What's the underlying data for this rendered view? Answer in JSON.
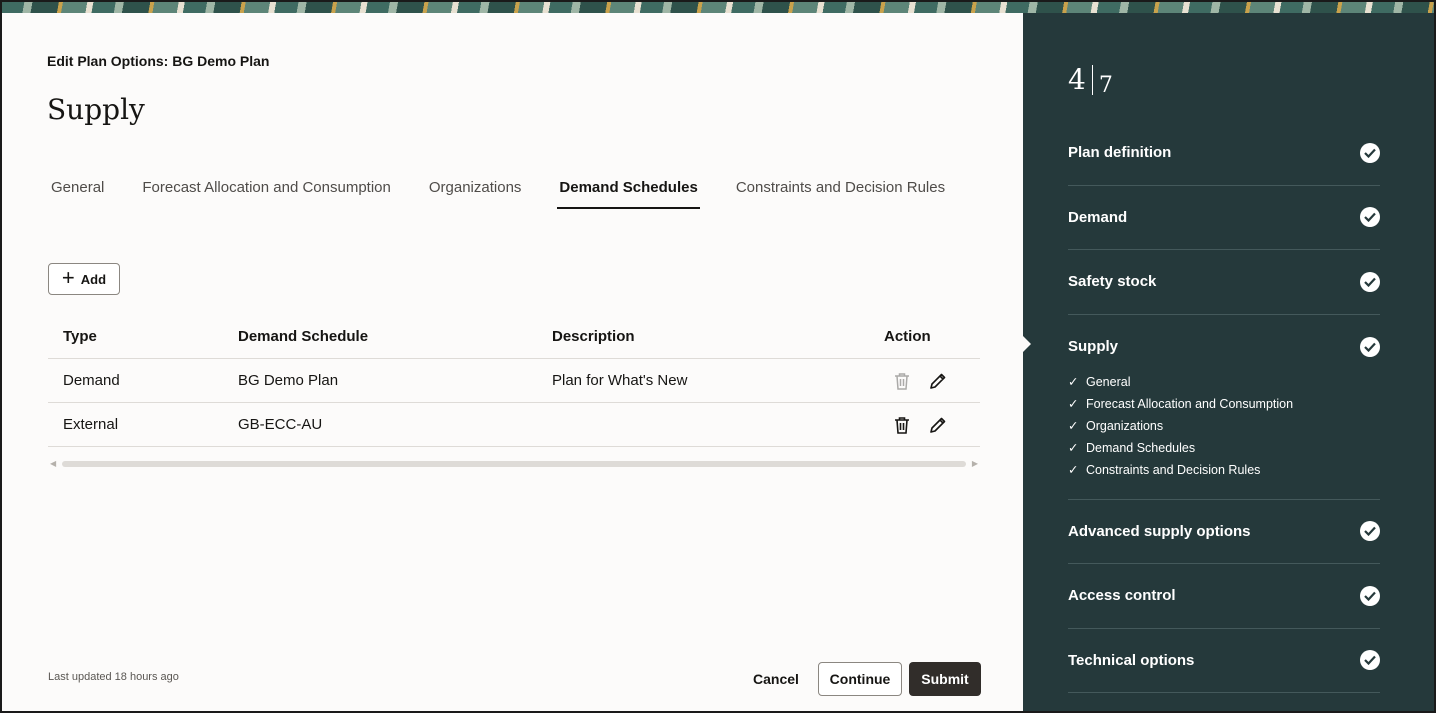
{
  "page": {
    "subtitle": "Edit Plan Options: BG Demo Plan",
    "title": "Supply"
  },
  "tabs": [
    {
      "label": "General"
    },
    {
      "label": "Forecast Allocation and Consumption"
    },
    {
      "label": "Organizations"
    },
    {
      "label": "Demand Schedules",
      "active": true
    },
    {
      "label": "Constraints and Decision Rules"
    }
  ],
  "toolbar": {
    "add_label": "Add"
  },
  "table": {
    "headers": [
      "Type",
      "Demand Schedule",
      "Description",
      "Action"
    ],
    "rows": [
      {
        "type": "Demand",
        "schedule": "BG Demo Plan",
        "description": "Plan for What's New",
        "delete_disabled": true
      },
      {
        "type": "External",
        "schedule": "GB-ECC-AU",
        "description": "",
        "delete_disabled": false
      }
    ]
  },
  "footer": {
    "last_updated": "Last updated 18 hours ago",
    "cancel_label": "Cancel",
    "continue_label": "Continue",
    "submit_label": "Submit"
  },
  "train": {
    "current": "4",
    "total": "7",
    "steps": [
      {
        "label": "Plan definition"
      },
      {
        "label": "Demand"
      },
      {
        "label": "Safety stock"
      },
      {
        "label": "Supply",
        "current": true,
        "substeps": [
          "General",
          "Forecast Allocation and Consumption",
          "Organizations",
          "Demand Schedules",
          "Constraints and Decision Rules"
        ]
      },
      {
        "label": "Advanced supply options"
      },
      {
        "label": "Access control"
      },
      {
        "label": "Technical options"
      }
    ]
  },
  "colors": {
    "sidebar_bg": "#25393b",
    "primary_button": "#312d2a",
    "page_bg": "#fcfbfa"
  }
}
